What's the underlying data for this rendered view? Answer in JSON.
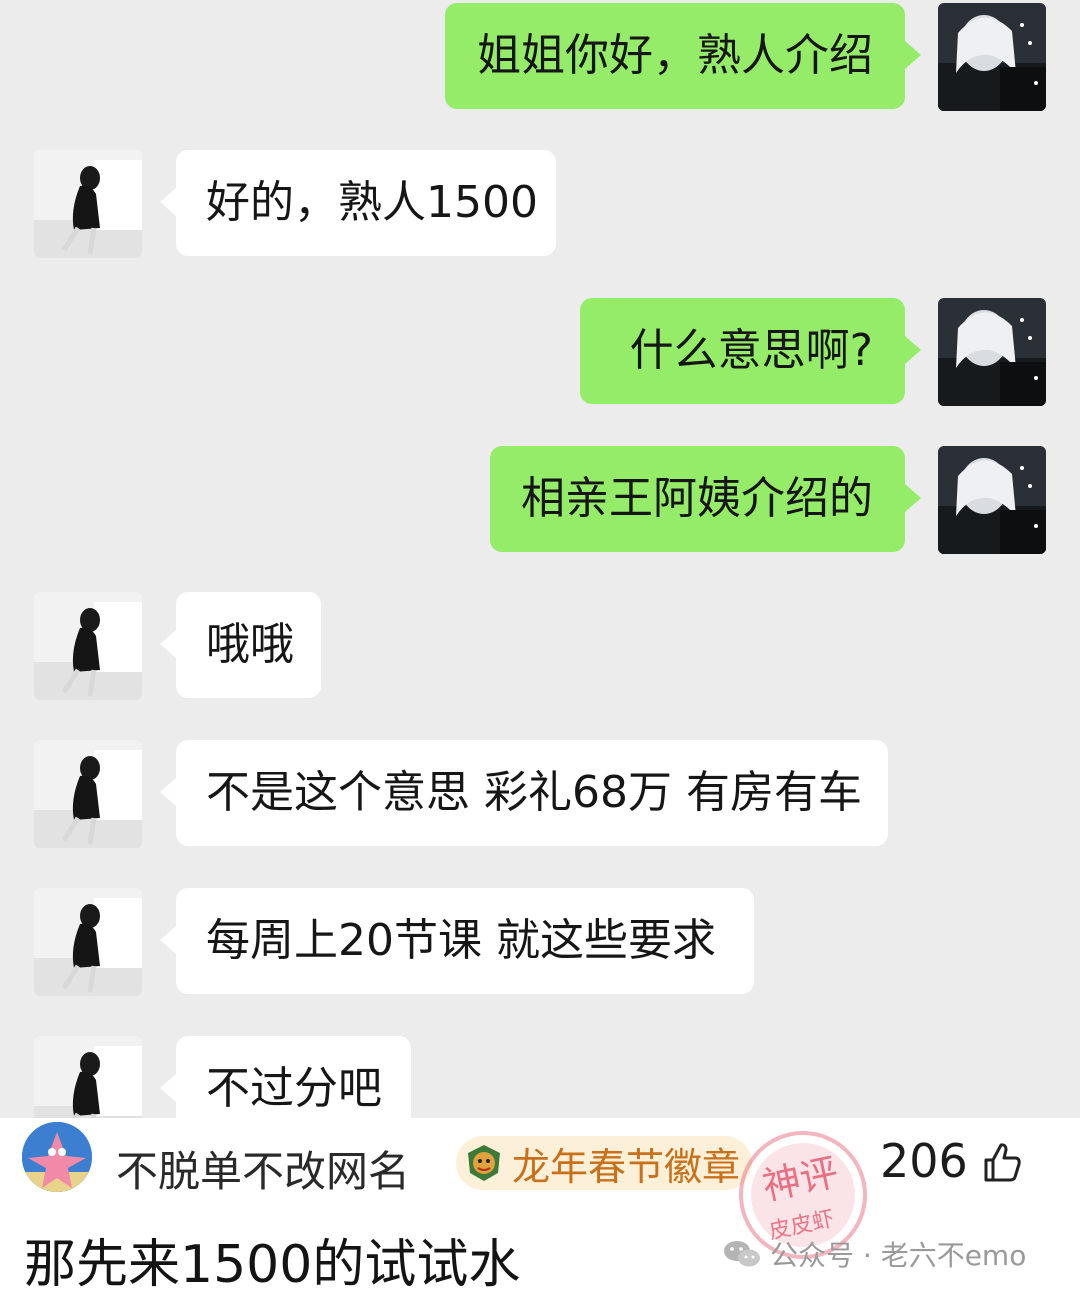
{
  "chat": {
    "messages": [
      {
        "side": "out",
        "text": "姐姐你好，熟人介绍"
      },
      {
        "side": "in",
        "text": "好的，熟人1500"
      },
      {
        "side": "out",
        "text": "什么意思啊?"
      },
      {
        "side": "out",
        "text": "相亲王阿姨介绍的"
      },
      {
        "side": "in",
        "text": "哦哦"
      },
      {
        "side": "in",
        "text": "不是这个意思 彩礼68万 有房有车"
      },
      {
        "side": "in",
        "text": "每周上20节课 就这些要求"
      },
      {
        "side": "in",
        "text": "不过分吧"
      }
    ],
    "colors": {
      "outgoing_bubble": "#95ec69",
      "incoming_bubble": "#ffffff",
      "background": "#ececec"
    }
  },
  "comment": {
    "username": "不脱单不改网名",
    "badge": {
      "text": "龙年春节徽章",
      "icon": "dragon-badge-icon",
      "color": "#c8701a"
    },
    "likes": "206",
    "like_icon": "thumbs-up-icon",
    "text": "那先来1500的试试水",
    "stamp": {
      "text": "神评",
      "sub": "皮皮虾"
    }
  },
  "watermark": {
    "text": "公众号 · 老六不emo",
    "icon": "wechat-icon"
  }
}
